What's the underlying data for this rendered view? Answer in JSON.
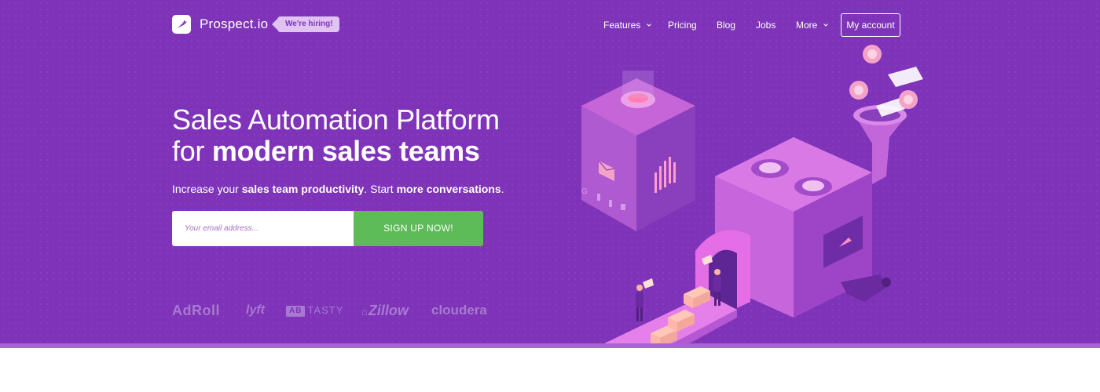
{
  "brand": {
    "name": "Prospect.io",
    "hiring_badge": "We're hiring!",
    "logo_icon": "carrot-icon"
  },
  "nav": {
    "items": [
      {
        "label": "Features",
        "has_dropdown": true
      },
      {
        "label": "Pricing",
        "has_dropdown": false
      },
      {
        "label": "Blog",
        "has_dropdown": false
      },
      {
        "label": "Jobs",
        "has_dropdown": false
      },
      {
        "label": "More",
        "has_dropdown": true
      }
    ],
    "account_button": "My account"
  },
  "hero": {
    "headline_line1": "Sales Automation Platform",
    "headline_line2_prefix": "for",
    "headline_line2_bold": "modern sales teams",
    "sub_part1": "Increase your",
    "sub_bold1": "sales team productivity",
    "sub_part2": ". Start",
    "sub_bold2": "more conversations",
    "sub_part3": "."
  },
  "signup": {
    "email_placeholder": "Your email address...",
    "button_label": "SIGN UP NOW!"
  },
  "client_logos": [
    {
      "name": "AdRoll"
    },
    {
      "name": "lyft"
    },
    {
      "name": "TASTY"
    },
    {
      "name": "Zillow"
    },
    {
      "name": "cloudera"
    }
  ],
  "colors": {
    "background": "#7e33b8",
    "cta_green": "#5dbb58",
    "badge": "#e0c3f2",
    "logo_muted": "#a879d1",
    "machine_pink": "#d56fe0"
  }
}
